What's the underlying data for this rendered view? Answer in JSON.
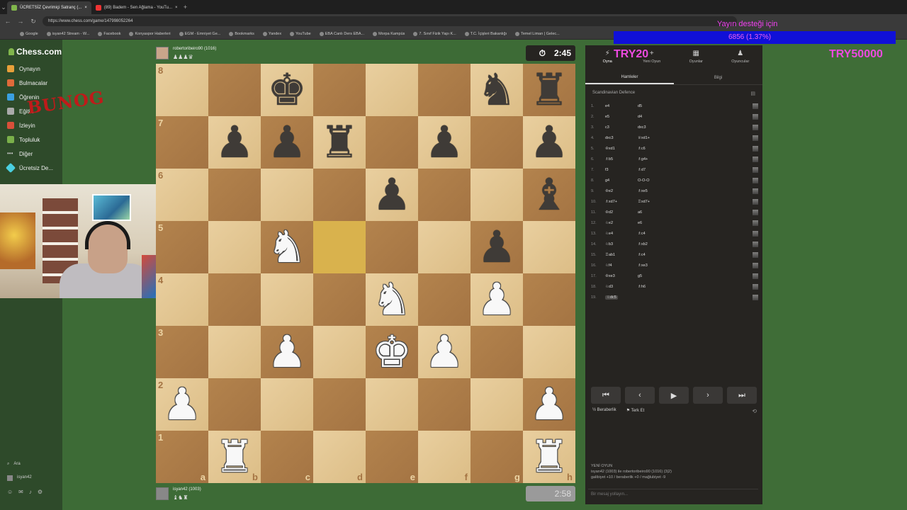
{
  "browser": {
    "tabs": [
      {
        "label": "ÜCRETSİZ Çevrimiçi Satranç (...",
        "active": true
      },
      {
        "label": "(89) Badem - Sen Ağlama - YouTu...",
        "active": false
      }
    ],
    "url": "https://www.chess.com/game/147998052264",
    "bookmarks": [
      "Google",
      "isyan42 Stream - W...",
      "Facebook",
      "Konyaspor Haberleri",
      "EGM - Emniyet Ge...",
      "Bookmarks",
      "Yandex",
      "YouTube",
      "EBA Canlı Ders EBA...",
      "Morpa Kampüs",
      "7. Sınıf Fizik Yapı K...",
      "T.C. İçişleri Bakanlığı",
      "Temel Liman | Gelec..."
    ]
  },
  "sidebar": {
    "logo": "Chess.com",
    "items": [
      {
        "label": "Oynayın"
      },
      {
        "label": "Bulmacalar"
      },
      {
        "label": "Öğrenin"
      },
      {
        "label": "Eğitin"
      },
      {
        "label": "İzleyin"
      },
      {
        "label": "Topluluk"
      },
      {
        "label": "Diğer"
      },
      {
        "label": "Ücretsiz De..."
      }
    ],
    "search": "Ara",
    "username": "isyan42"
  },
  "overlay": {
    "bunog": "BUNOG",
    "donate_text": "Yayın desteği için",
    "donate_pct": "6856 (1.37%)",
    "try20": "TRY20",
    "try50000": "TRY50000"
  },
  "player_top": {
    "name": "robertoribeiro90 (1016)",
    "captured": "♟♟♟♛",
    "clock": "2:45"
  },
  "player_bottom": {
    "name": "isyan42 (1003)",
    "captured": "♝♞♜",
    "clock": "2:58"
  },
  "board": {
    "ranks": [
      "8",
      "7",
      "6",
      "5",
      "4",
      "3",
      "2",
      "1"
    ],
    "files": [
      "a",
      "b",
      "c",
      "d",
      "e",
      "f",
      "g",
      "h"
    ],
    "rows": [
      [
        "",
        "",
        "bk",
        "",
        "",
        "",
        "bn",
        "br"
      ],
      [
        "",
        "bp",
        "bp",
        "br",
        "",
        "bp",
        "",
        "bp"
      ],
      [
        "",
        "",
        "",
        "",
        "bp",
        "",
        "",
        "bb"
      ],
      [
        "",
        "",
        "wn",
        "",
        "",
        "",
        "bp",
        ""
      ],
      [
        "",
        "",
        "",
        "",
        "wn",
        "",
        "wp",
        ""
      ],
      [
        "",
        "",
        "wp",
        "",
        "wk",
        "wp",
        "",
        ""
      ],
      [
        "wp",
        "",
        "",
        "",
        "",
        "",
        "",
        "wp"
      ],
      [
        "",
        "wr",
        "",
        "",
        "",
        "",
        "",
        "wr"
      ]
    ]
  },
  "panel": {
    "tabs": [
      "Oyna",
      "Yeni Oyun",
      "Oyunlar",
      "Oyuncular"
    ],
    "subtabs": [
      "Hamleler",
      "Bilgi"
    ],
    "opening": "Scandinavian Defence",
    "moves": [
      [
        "1.",
        "e4",
        "d5"
      ],
      [
        "2.",
        "e5",
        "d4"
      ],
      [
        "3.",
        "c3",
        "dxc3"
      ],
      [
        "4.",
        "dxc3",
        "♕xd1+"
      ],
      [
        "5.",
        "♔xd1",
        "♗c6"
      ],
      [
        "6.",
        "♗b5",
        "♗g4+"
      ],
      [
        "7.",
        "f3",
        "♗d7"
      ],
      [
        "8.",
        "g4",
        "O-O-O"
      ],
      [
        "9.",
        "♔e2",
        "♗xe5"
      ],
      [
        "10.",
        "♗xd7+",
        "♖xd7+"
      ],
      [
        "11.",
        "♔d2",
        "a6"
      ],
      [
        "12.",
        "♘e2",
        "e6"
      ],
      [
        "13.",
        "♘e4",
        "♗c4"
      ],
      [
        "14.",
        "♘b3",
        "♗xb2"
      ],
      [
        "15.",
        "♖ab1",
        "♗c4"
      ],
      [
        "16.",
        "♘f4",
        "♗xe3"
      ],
      [
        "17.",
        "♔xe3",
        "g5"
      ],
      [
        "18.",
        "♘d3",
        "♗h6"
      ],
      [
        "19.",
        "♘dc5",
        ""
      ]
    ],
    "actions": [
      "Beraberlik",
      "Terk Et"
    ],
    "newgame_title": "YENİ OYUN",
    "newgame_line1": "isyan42 (1003) ile robertoribeiro90 (1016) (3|2)",
    "newgame_line2": "galibiyet +10 / beraberlik +0 / mağlubiyet -9",
    "chat_placeholder": "Bir mesaj yollayın..."
  }
}
